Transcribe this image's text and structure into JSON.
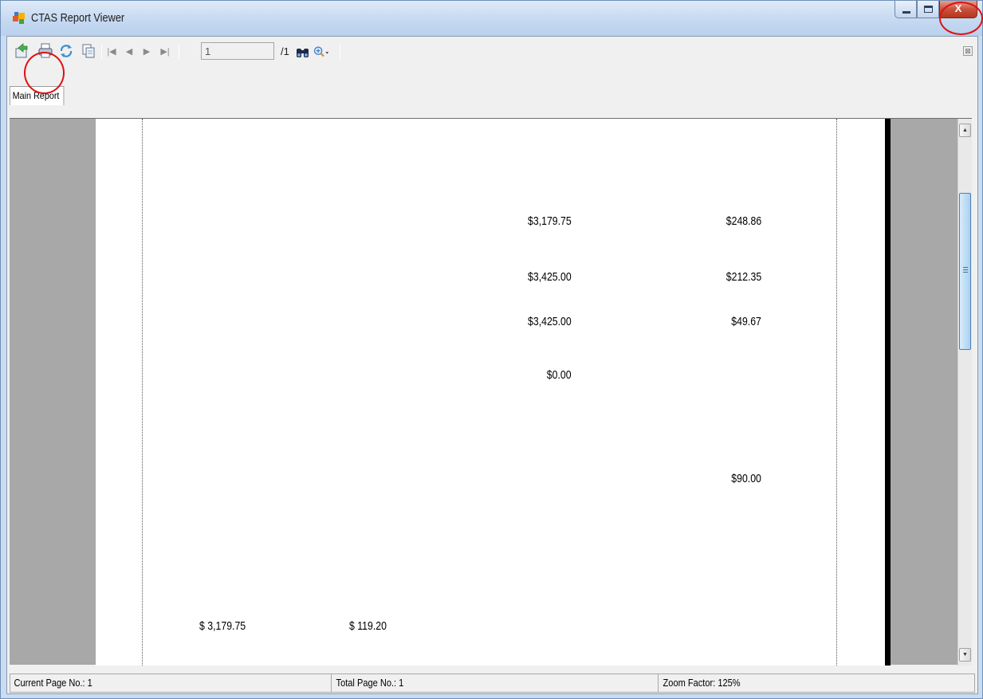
{
  "window": {
    "title": "CTAS Report Viewer",
    "close_label": "X"
  },
  "toolbar": {
    "page_number": "1",
    "page_total": "/1",
    "close_glyph": "⊠"
  },
  "tabs": [
    {
      "label": "Main Report"
    }
  ],
  "report": {
    "rows": [
      {
        "col_a": "$3,179.75",
        "col_b": "$248.86"
      },
      {
        "col_a": "$3,425.00",
        "col_b": "$212.35"
      },
      {
        "col_a": "$3,425.00",
        "col_b": "$49.67"
      },
      {
        "col_a": "$0.00",
        "col_b": ""
      },
      {
        "col_a": "",
        "col_b": "$90.00"
      }
    ],
    "footer": {
      "amount_1": "$ 3,179.75",
      "amount_2": "$ 119.20"
    }
  },
  "status": {
    "current_page": "Current Page No.: 1",
    "total_pages": "Total Page No.: 1",
    "zoom": "Zoom Factor: 125%"
  },
  "highlight_color": "#e01010",
  "icons": [
    "app-icon",
    "export-icon",
    "print-icon",
    "refresh-icon",
    "copy-icon",
    "first-page-icon",
    "previous-page-icon",
    "next-page-icon",
    "last-page-icon",
    "find-icon",
    "zoom-icon"
  ]
}
